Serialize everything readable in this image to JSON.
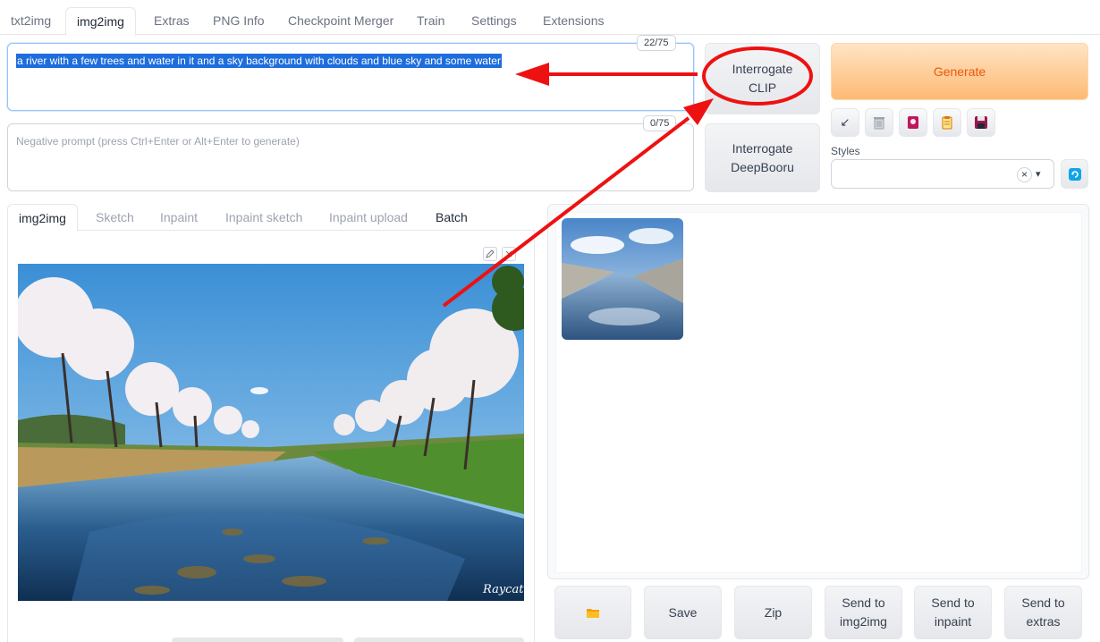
{
  "top_tabs": [
    {
      "label": "txt2img"
    },
    {
      "label": "img2img"
    },
    {
      "label": "Extras"
    },
    {
      "label": "PNG Info"
    },
    {
      "label": "Checkpoint Merger"
    },
    {
      "label": "Train"
    },
    {
      "label": "Settings"
    },
    {
      "label": "Extensions"
    }
  ],
  "prompt": {
    "value": "a river with a few trees and water in it and a sky background with clouds and blue sky and some water",
    "token_count": "22/75"
  },
  "negative_prompt": {
    "placeholder": "Negative prompt (press Ctrl+Enter or Alt+Enter to generate)",
    "token_count": "0/75"
  },
  "interrogate": {
    "clip_line1": "Interrogate",
    "clip_line2": "CLIP",
    "deepbooru_line1": "Interrogate",
    "deepbooru_line2": "DeepBooru"
  },
  "generate_label": "Generate",
  "tools": [
    {
      "icon": "arrow-icon",
      "symbol": "↙"
    },
    {
      "icon": "trash-icon",
      "symbol": "🗑"
    },
    {
      "icon": "extra-networks-icon",
      "symbol": "🎴"
    },
    {
      "icon": "clipboard-icon",
      "symbol": "📋"
    },
    {
      "icon": "save-style-icon",
      "symbol": "💾"
    }
  ],
  "styles": {
    "label": "Styles",
    "clear_symbol": "×",
    "caret_symbol": "▾"
  },
  "sub_tabs": [
    {
      "label": "img2img"
    },
    {
      "label": "Sketch"
    },
    {
      "label": "Inpaint"
    },
    {
      "label": "Inpaint sketch"
    },
    {
      "label": "Inpaint upload"
    },
    {
      "label": "Batch"
    }
  ],
  "watermark": "Raycat",
  "output_buttons": {
    "folder_symbol": "📁",
    "save": "Save",
    "zip": "Zip",
    "send_img2img_1": "Send to",
    "send_img2img_2": "img2img",
    "send_inpaint_1": "Send to",
    "send_inpaint_2": "inpaint",
    "send_extras_1": "Send to",
    "send_extras_2": "extras"
  },
  "colors": {
    "annotation_red": "#ee1111",
    "selection_blue": "#1e6ddc",
    "generate_orange": "#ea580c"
  }
}
